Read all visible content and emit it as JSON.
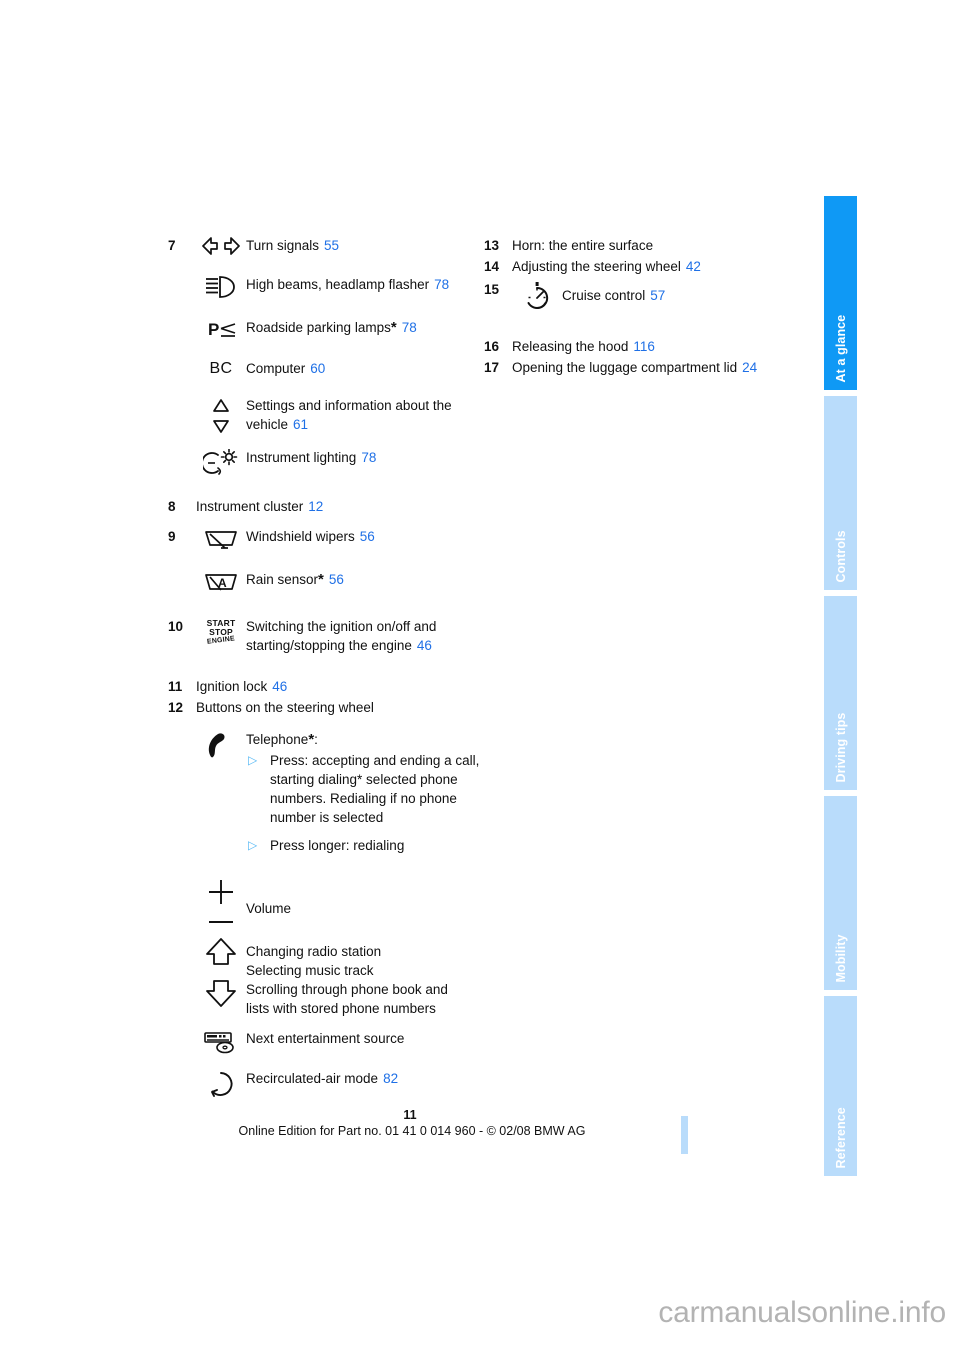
{
  "document": {
    "page_number": "11",
    "footer_note": "Online Edition for Part no. 01 41 0 014 960 - © 02/08 BMW AG",
    "watermark": "carmanualsonline.info"
  },
  "colors": {
    "link": "#1f70e6",
    "tab_active": "#0f99f5",
    "tab_inactive": "#b9dcfb",
    "bullet": "#55b8f5"
  },
  "tab_rail": {
    "tabs": [
      {
        "label": "At a glance",
        "active": true
      },
      {
        "label": "Controls",
        "active": false
      },
      {
        "label": "Driving tips",
        "active": false
      },
      {
        "label": "Mobility",
        "active": false
      },
      {
        "label": "Reference",
        "active": false
      }
    ]
  },
  "left_column": {
    "item_7": {
      "number": "7",
      "entries": [
        {
          "icon": "turn-signals-icon",
          "label": "Turn signals",
          "page": "55"
        },
        {
          "icon": "high-beam-icon",
          "label": "High beams, headlamp flasher",
          "page": "78"
        },
        {
          "icon": "roadside-parking-lamps-icon",
          "label": "Roadside parking lamps",
          "asterisk": true,
          "page": "78"
        },
        {
          "icon": "bc-computer-icon",
          "label": "Computer",
          "page": "60"
        },
        {
          "icon": "up-down-arrows-icon",
          "label": "Settings and information about the vehicle",
          "page": "61"
        },
        {
          "icon": "instrument-lighting-icon",
          "label": "Instrument lighting",
          "page": "78"
        }
      ]
    },
    "item_8": {
      "number": "8",
      "label": "Instrument cluster",
      "page": "12"
    },
    "item_9": {
      "number": "9",
      "entries": [
        {
          "icon": "windshield-wiper-icon",
          "label": "Windshield wipers",
          "page": "56"
        },
        {
          "icon": "rain-sensor-icon",
          "label": "Rain sensor",
          "asterisk": true,
          "page": "56"
        }
      ]
    },
    "item_10": {
      "number": "10",
      "icon": "start-stop-engine-icon",
      "icon_text": {
        "line1": "START",
        "line2": "STOP",
        "line3": "ENGINE"
      },
      "label_line1": "Switching the ignition on/off and",
      "label_line2": "starting/stopping the engine",
      "page": "46"
    },
    "item_11": {
      "number": "11",
      "label": "Ignition lock",
      "page": "46"
    },
    "item_12": {
      "number": "12",
      "label": "Buttons on the steering wheel",
      "entries": [
        {
          "icon": "telephone-handset-icon",
          "label": "Telephone",
          "asterisk": true,
          "suffix": ":",
          "bullets": [
            "Press: accepting and ending a call, starting dialing* selected phone numbers. Redialing if no phone number is selected",
            "Press longer: redialing"
          ]
        },
        {
          "icon": "plus-minus-icon",
          "label": "Volume"
        },
        {
          "icon": "up-down-thick-arrows-icon",
          "lines": [
            "Changing radio station",
            "Selecting music track",
            "Scrolling through phone book and",
            "lists with stored phone numbers"
          ]
        },
        {
          "icon": "entertainment-source-icon",
          "label": "Next entertainment source"
        },
        {
          "icon": "recirculated-air-icon",
          "label": "Recirculated-air mode",
          "page": "82"
        }
      ]
    }
  },
  "right_column": {
    "item_13": {
      "number": "13",
      "label": "Horn: the entire surface"
    },
    "item_14": {
      "number": "14",
      "label": "Adjusting the steering wheel",
      "page": "42"
    },
    "item_15": {
      "number": "15",
      "icon": "cruise-control-icon",
      "label": "Cruise control",
      "page": "57"
    },
    "item_16": {
      "number": "16",
      "label": "Releasing the hood",
      "page": "116"
    },
    "item_17": {
      "number": "17",
      "label": "Opening the luggage compartment lid",
      "page": "24"
    }
  }
}
